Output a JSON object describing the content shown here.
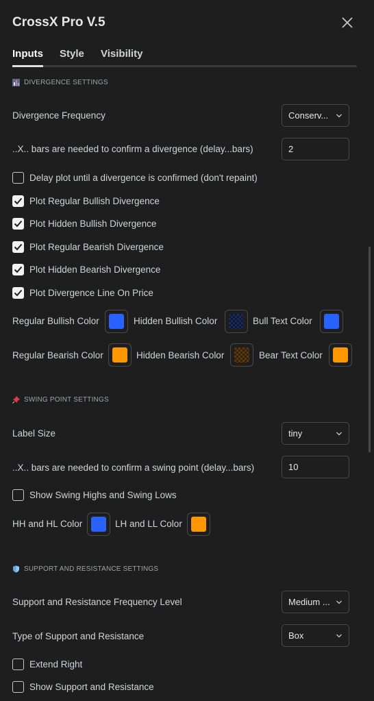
{
  "header": {
    "title": "CrossX Pro V.5"
  },
  "tabs": [
    {
      "label": "Inputs",
      "active": true
    },
    {
      "label": "Style",
      "active": false
    },
    {
      "label": "Visibility",
      "active": false
    }
  ],
  "divergence": {
    "section_title": "DIVERGENCE SETTINGS",
    "section_icon": "bar-chart-icon",
    "frequency": {
      "label": "Divergence Frequency",
      "value": "Conserv..."
    },
    "confirm_bars": {
      "label": "..X.. bars are needed to confirm a divergence (delay...bars)",
      "value": "2"
    },
    "checkboxes": [
      {
        "label": "Delay plot until a divergence is confirmed (don't repaint)",
        "checked": false
      },
      {
        "label": "Plot Regular Bullish Divergence",
        "checked": true
      },
      {
        "label": "Plot Hidden Bullish Divergence",
        "checked": true
      },
      {
        "label": "Plot Regular Bearish Divergence",
        "checked": true
      },
      {
        "label": "Plot Hidden Bearish Divergence",
        "checked": true
      },
      {
        "label": "Plot Divergence Line On Price",
        "checked": true
      }
    ],
    "colors_row1": [
      {
        "label": "Regular Bullish Color",
        "color": "#2962ff"
      },
      {
        "label": "Hidden Bullish Color",
        "color": "#1c2b59"
      },
      {
        "label": "Bull Text Color",
        "color": "#2962ff"
      }
    ],
    "colors_row2": [
      {
        "label": "Regular Bearish Color",
        "color": "#ff9800"
      },
      {
        "label": "Hidden Bearish Color",
        "color": "#5a3a12"
      },
      {
        "label": "Bear Text Color",
        "color": "#ff9800"
      }
    ]
  },
  "swing": {
    "section_title": "SWING POINT SETTINGS",
    "section_icon": "pushpin-icon",
    "label_size": {
      "label": "Label Size",
      "value": "tiny"
    },
    "confirm_bars": {
      "label": "..X.. bars are needed to confirm a swing point (delay...bars)",
      "value": "10"
    },
    "show_swing": {
      "label": "Show Swing Highs and Swing Lows",
      "checked": false
    },
    "hh_hl": {
      "label": "HH and HL Color",
      "color": "#2962ff"
    },
    "lh_ll": {
      "label": "LH and LL Color",
      "color": "#ff9800"
    }
  },
  "sr": {
    "section_title": "SUPPORT AND RESISTANCE SETTINGS",
    "section_icon": "shield-icon",
    "frequency": {
      "label": "Support and Resistance Frequency Level",
      "value": "Medium ..."
    },
    "type": {
      "label": "Type of Support and Resistance",
      "value": "Box"
    },
    "extend_right": {
      "label": "Extend Right",
      "checked": false
    },
    "show_sr": {
      "label": "Show Support and Resistance",
      "checked": false
    }
  },
  "colors": {
    "background": "#1e1e1e",
    "text": "#d1d4dc",
    "border": "#4a4a4a"
  }
}
